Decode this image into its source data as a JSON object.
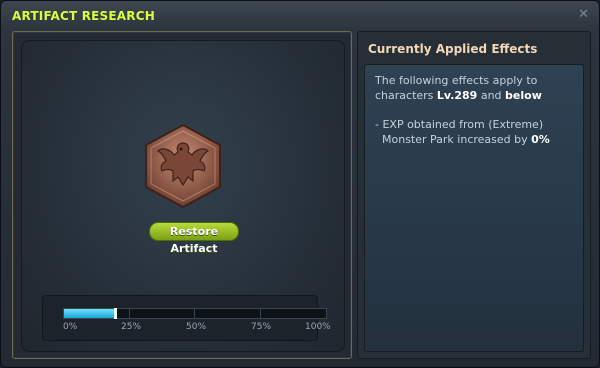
{
  "window": {
    "title": "ARTIFACT RESEARCH",
    "close_icon": "close-icon"
  },
  "artifact": {
    "icon": "eagle-emblem-icon",
    "restore_label": "Restore Artifact"
  },
  "progress": {
    "value": 0.2,
    "ticks": [
      "0%",
      "25%",
      "50%",
      "75%",
      "100%"
    ]
  },
  "effects": {
    "header": "Currently Applied Effects",
    "intro_prefix": "The following effects apply to",
    "intro_line2_prefix": "characters",
    "level": "Lv.289",
    "and": "and",
    "below": "below",
    "effect_prefix": "- EXP obtained from (Extreme)",
    "effect_line2": "Monster Park increased by",
    "effect_value": "0%"
  },
  "colors": {
    "title": "#d6ff3a",
    "button": "#9cc428",
    "progress": "#2bb8e8"
  }
}
